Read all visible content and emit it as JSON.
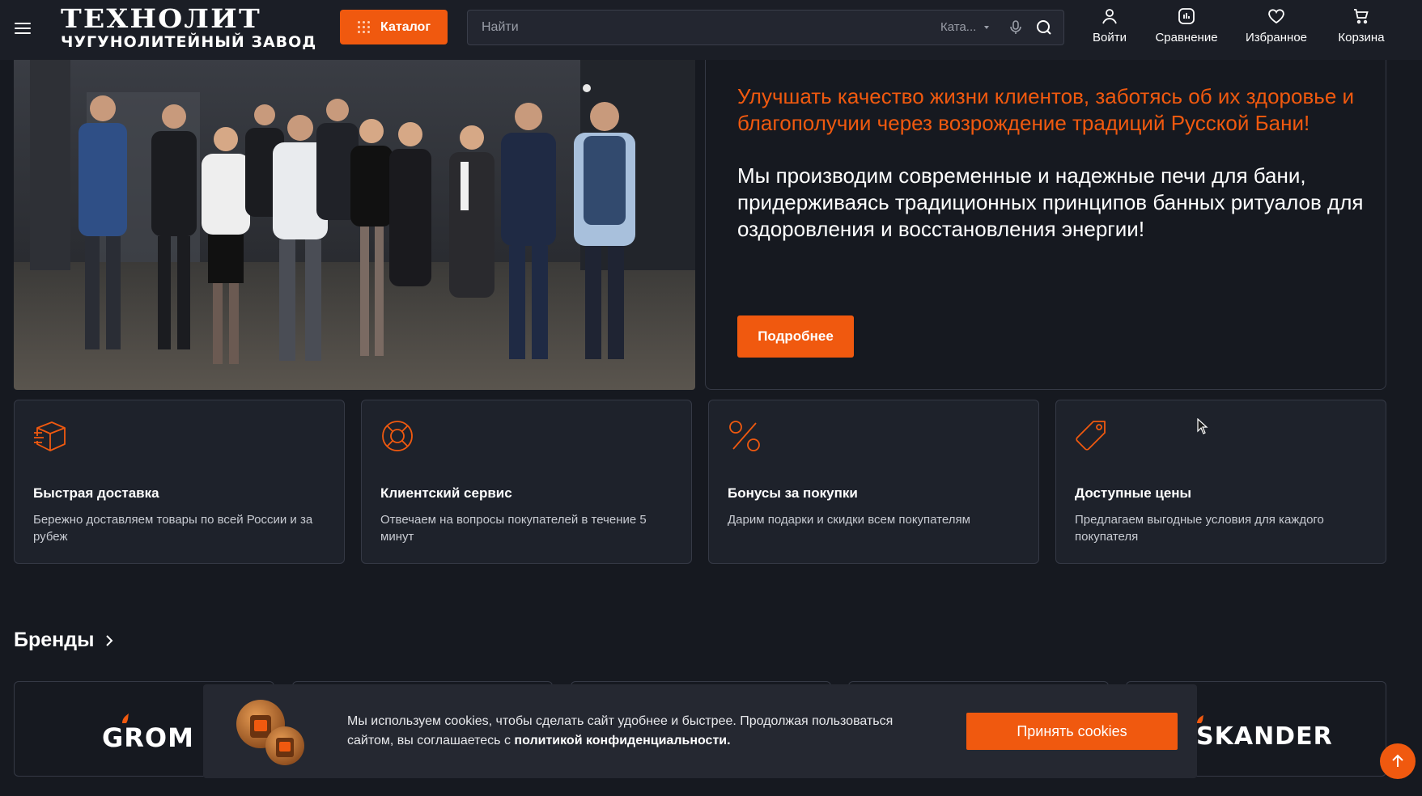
{
  "header": {
    "logo_top": "ТЕХНОЛИТ",
    "logo_bottom": "ЧУГУНОЛИТЕЙНЫЙ ЗАВОД",
    "catalog_label": "Каталог",
    "search_placeholder": "Найти",
    "search_scope": "Ката...",
    "nav": [
      {
        "label": "Войти",
        "icon": "user-icon"
      },
      {
        "label": "Сравнение",
        "icon": "compare-icon"
      },
      {
        "label": "Избранное",
        "icon": "heart-icon"
      },
      {
        "label": "Корзина",
        "icon": "cart-icon"
      }
    ]
  },
  "mission": {
    "accent_text": "Улучшать качество жизни клиентов, заботясь об их здоровье и благополучии через возрождение традиций Русской Бани!",
    "main_text": "Мы производим современные и надежные печи для бани, придерживаясь традиционных принципов банных ритуалов для оздоровления и восстановления энергии!",
    "button_label": "Подробнее"
  },
  "features": [
    {
      "title": "Быстрая доставка",
      "desc": "Бережно доставляем товары по всей России и за рубеж",
      "icon": "box-icon"
    },
    {
      "title": "Клиентский сервис",
      "desc": "Отвечаем на вопросы покупателей в течение 5 минут",
      "icon": "lifebuoy-icon"
    },
    {
      "title": "Бонусы за покупки",
      "desc": "Дарим подарки и скидки всем покупателям",
      "icon": "percent-icon"
    },
    {
      "title": "Доступные цены",
      "desc": "Предлагаем выгодные условия для каждого покупателя",
      "icon": "price-tag-icon"
    }
  ],
  "brands": {
    "title": "Бренды",
    "items": [
      "GROM",
      "SKANDER"
    ]
  },
  "cookie": {
    "text": "Мы используем cookies, чтобы сделать сайт удобнее и быстрее. Продолжая пользоваться сайтом, вы соглашаетесь с",
    "link": "политикой конфиденциальности.",
    "button_label": "Принять cookies"
  },
  "colors": {
    "accent": "#f0590f",
    "background": "#161920",
    "card": "#1e222b"
  }
}
